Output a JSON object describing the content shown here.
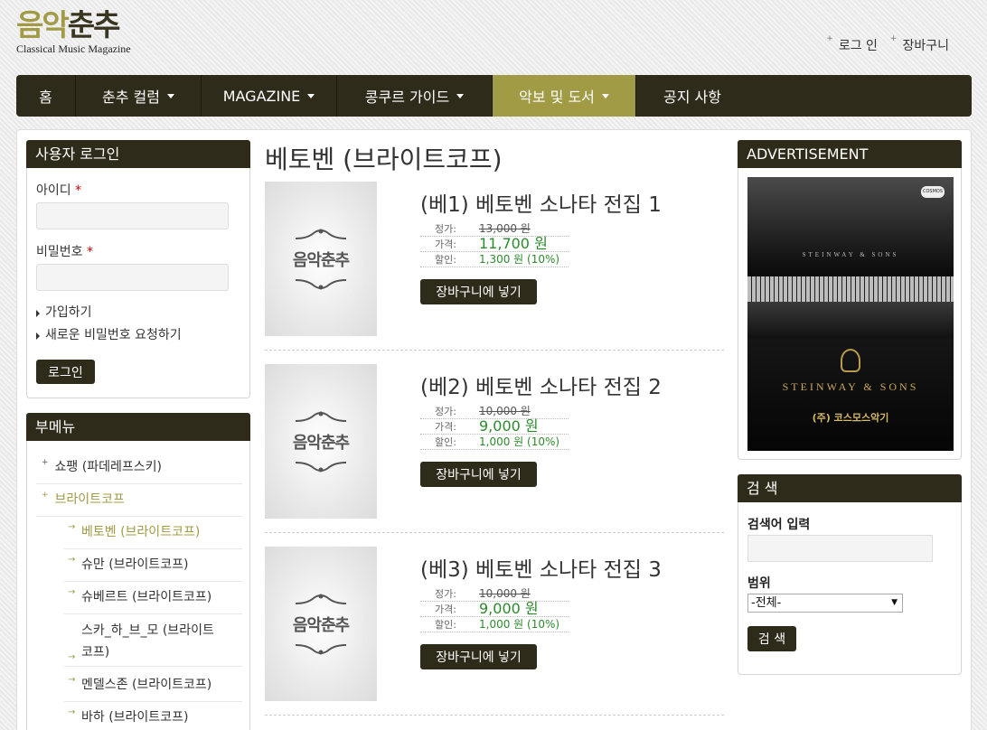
{
  "header": {
    "logo_part1": "음악",
    "logo_part2": "춘추",
    "logo_sub": "Classical Music Magazine",
    "top_links": [
      "로그 인",
      "장바구니"
    ]
  },
  "nav": {
    "items": [
      {
        "label": "홈",
        "dropdown": false
      },
      {
        "label": "춘추 컬럼",
        "dropdown": true
      },
      {
        "label": "MAGAZINE",
        "dropdown": true
      },
      {
        "label": "콩쿠르 가이드",
        "dropdown": true
      },
      {
        "label": "악보 및 도서",
        "dropdown": true,
        "active": true
      },
      {
        "label": "공지 사항",
        "dropdown": false
      }
    ]
  },
  "login": {
    "title": "사용자 로그인",
    "id_label": "아이디",
    "pw_label": "비밀번호",
    "required_mark": "*",
    "links": [
      "가입하기",
      "새로운 비밀번호 요청하기"
    ],
    "button": "로그인"
  },
  "submenu": {
    "title": "부메뉴",
    "items": [
      "쇼팽 (파데레프스키)",
      "브라이트코프"
    ],
    "sub_items": [
      "베토벤 (브라이트코프)",
      "슈만 (브라이트코프)",
      "슈베르트 (브라이트코프)",
      "스카_하_브_모 (브라이트",
      "코프)",
      "멘델스존 (브라이트코프)",
      "바하 (브라이트코프)"
    ]
  },
  "page": {
    "title": "베토벤 (브라이트코프)",
    "thumb_text": "음악춘추",
    "price_labels": {
      "list": "정가:",
      "price": "가격:",
      "discount": "할인:"
    },
    "cart_button": "장바구니에 넣기"
  },
  "products": [
    {
      "title": "(베1) 베토벤 소나타 전집 1",
      "list_price": "13,000 원",
      "price": "11,700 원",
      "discount": "1,300 원 (10%)"
    },
    {
      "title": "(베2) 베토벤 소나타 전집 2",
      "list_price": "10,000 원",
      "price": "9,000 원",
      "discount": "1,000 원 (10%)"
    },
    {
      "title": "(베3) 베토벤 소나타 전집 3",
      "list_price": "10,000 원",
      "price": "9,000 원",
      "discount": "1,000 원 (10%)"
    }
  ],
  "ad": {
    "title": "ADVERTISEMENT",
    "badge": "COSMOS",
    "piano_brand": "STEINWAY & SONS",
    "brand": "STEINWAY & SONS",
    "dealer": "(주) 코스모스악기"
  },
  "search": {
    "title": "검 색",
    "input_label": "검색어 입력",
    "scope_label": "범위",
    "scope_value": "-전체-",
    "button": "검 색"
  },
  "colors": {
    "dark": "#2f2b1a",
    "accent": "#a19b45",
    "price_green": "#2d8a2d"
  }
}
